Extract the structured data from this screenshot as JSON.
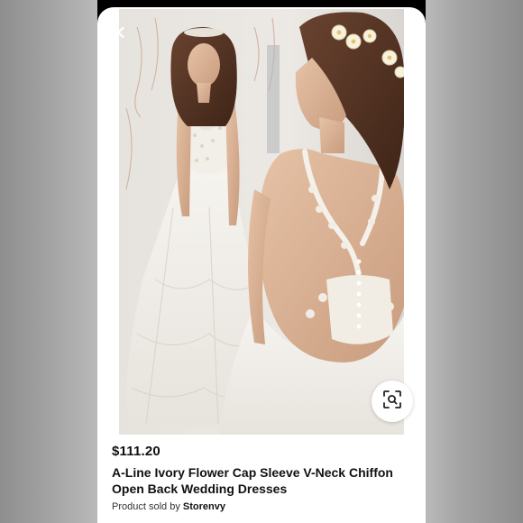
{
  "product": {
    "price": "$111.20",
    "title": "A-Line Ivory Flower Cap Sleeve V-Neck Chiffon\nOpen Back Wedding Dresses",
    "sold_by_prefix": "Product sold by ",
    "seller_name": "Storenvy"
  },
  "icons": {
    "back": "chevron-left-icon",
    "zoom": "visual-search-icon"
  },
  "colors": {
    "card_background": "#ffffff",
    "text": "#111111"
  }
}
